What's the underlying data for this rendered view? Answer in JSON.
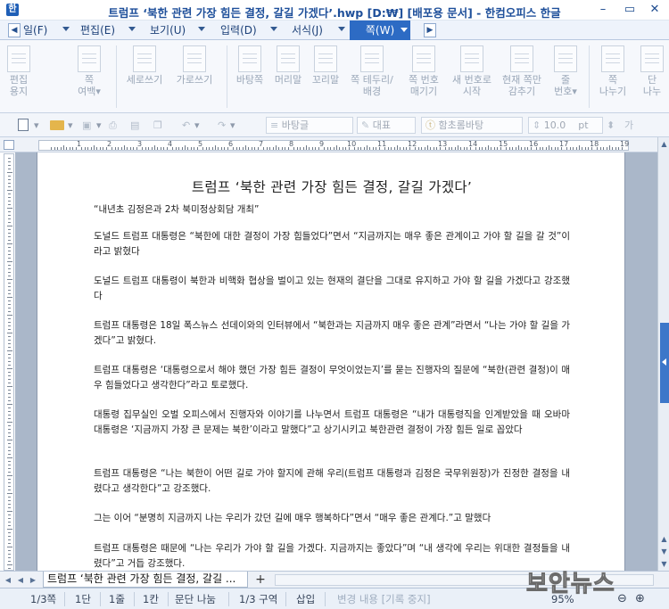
{
  "window": {
    "title": "트럼프 ‘북한 관련 가장 힘든 결정, 갈길 가겠다’.hwp [D:₩] [배포용 문서] - 한컴오피스 한글",
    "minimize": "–",
    "restore": "▭",
    "close": "✕"
  },
  "menu": {
    "items": [
      "일(F)",
      "편집(E)",
      "보기(U)",
      "입력(D)",
      "서식(J)"
    ],
    "active_tab": "쪽(W)",
    "search_placeholder": "찾을 내용을 입력하세요.",
    "right_controls": [
      "︿",
      "?",
      "✕"
    ]
  },
  "ribbon": {
    "buttons": [
      "편집\n용지",
      "쪽\n여백▾",
      "세로쓰기",
      "가로쓰기",
      "바탕쪽",
      "머리말",
      "꼬리말",
      "쪽 테두리/\n배경",
      "쪽 번호\n매기기",
      "새 번호로\n시작",
      "현재 쪽만\n감추기",
      "줄\n번호▾",
      "쪽\n나누기",
      "단\n나누"
    ]
  },
  "format_toolbar": {
    "style": "바탕글",
    "lang": "대표",
    "font": "함초롬바탕",
    "size": "10.0",
    "unit": "pt"
  },
  "ruler": {
    "numbers": [
      "1",
      "2",
      "3",
      "4",
      "5",
      "6",
      "7",
      "8",
      "9",
      "10",
      "11",
      "12",
      "13",
      "14",
      "15",
      "16",
      "17",
      "18",
      "19"
    ]
  },
  "document": {
    "title": "트럼프 ‘북한 관련 가장 힘든 결정, 갈길 가겠다’",
    "subtitle": "“내년초 김정은과 2차 북미정상회담 개최”",
    "paragraphs": [
      "도널드 트럼프 대통령은 “북한에 대한 결정이 가장 힘들었다”면서 “지금까지는 매우 좋은 관계이고 가야 할 길을 갈 것”이라고 밝혔다",
      "도널드 트럼프 대통령이 북한과 비핵화 협상을 벌이고 있는 현재의 결단을 그대로 유지하고 가야 할 길을 가겠다고 강조했다",
      "트럼프 대통령은 18일 폭스뉴스 선데이와의 인터뷰에서  “북한과는 지금까지 매우 좋은 관계”라면서 “나는 가야 할 길을 가겠다”고 밝혔다.",
      "트럼프 대통령은 ‘대통령으로서 해야 했던 가장 힘든 결정이 무엇이었는지’를 묻는 진행자의 질문에 “북한(관련 결정)이 매우 힘들었다고 생각한다”라고 토로했다.",
      "대통령 집무실인 오벌 오피스에서 진행자와 이야기를 나누면서 트럼프 대통령은 “내가 대통령직을 인계받았을 때 오바마 대통령은 ‘지금까지 가장 큰 문제는 북한’이라고 말했다”고 상기시키고 북한관련 결정이 가장 힘든 일로 꼽았다",
      "트럼프 대통령은 “나는 북한이 어떤 길로 가야 할지에 관해 우리(트럼프 대통령과 김정은 국무위원장)가 진정한 결정을 내렸다고 생각한다”고 강조했다.",
      "그는 이어 “분명히 지금까지 나는 우리가 갔던 길에 매우 행복하다”면서 “매우 좋은 관계다.”고 말했다",
      "트럼프 대통령은 때문에 “나는 우리가 가야 할 길을 가겠다. 지금까지는 좋았다”며 “내 생각에 우리는 위대한 결정들을 내렸다”고 거듭 강조했다."
    ]
  },
  "tabstrip": {
    "doc_tab": "트럼프 ‘북한 관련 가장 힘든 결정, 갈길 ...",
    "add_tab": "+"
  },
  "status": {
    "page": "1/3쪽",
    "column": "1단",
    "line": "1줄",
    "col": "1칸",
    "break": "문단 나눔",
    "section": "1/3 구역",
    "insert": "삽입",
    "track": "변경 내용 [기록 중지]",
    "zoom": "95%"
  },
  "watermark": "보안뉴스"
}
